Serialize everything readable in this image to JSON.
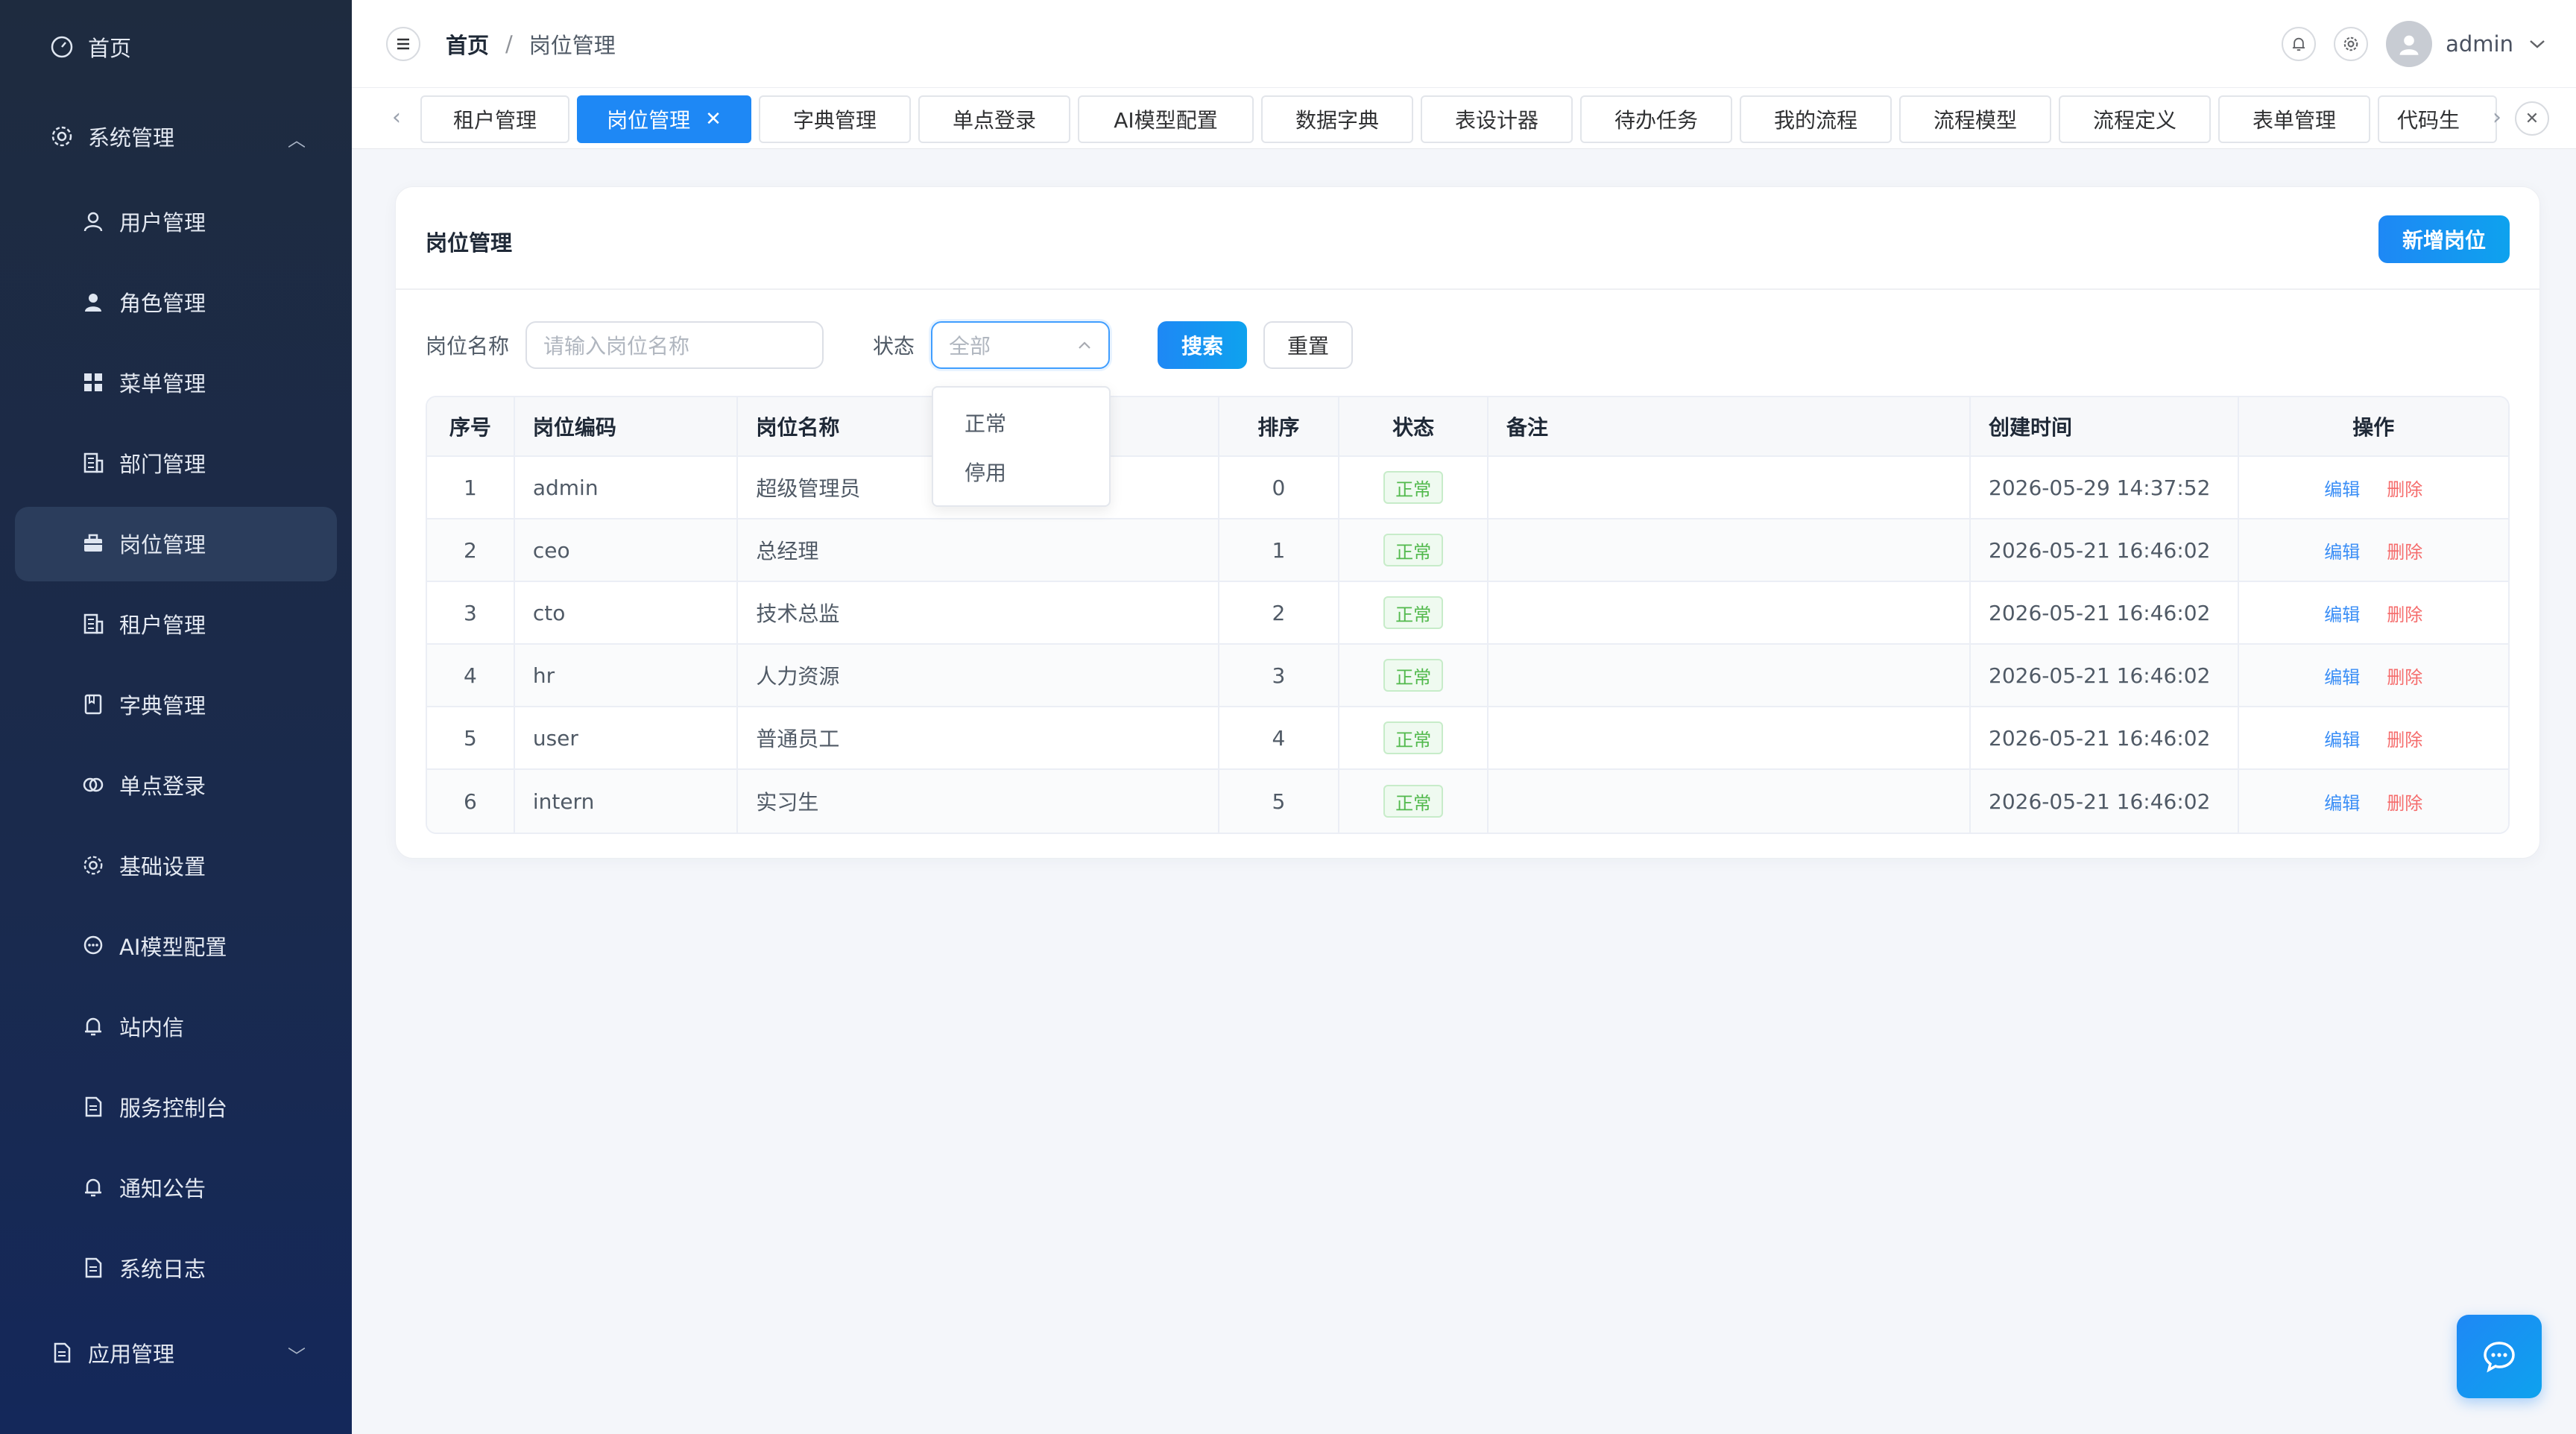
{
  "sidebar": {
    "items": [
      {
        "label": "首页",
        "icon": "dashboard-icon"
      },
      {
        "label": "系统管理",
        "icon": "gear-icon"
      },
      {
        "label": "用户管理",
        "icon": "user-icon"
      },
      {
        "label": "角色管理",
        "icon": "user-filled-icon"
      },
      {
        "label": "菜单管理",
        "icon": "grid-icon"
      },
      {
        "label": "部门管理",
        "icon": "building-icon"
      },
      {
        "label": "岗位管理",
        "icon": "briefcase-icon"
      },
      {
        "label": "租户管理",
        "icon": "building-icon"
      },
      {
        "label": "字典管理",
        "icon": "notebook-icon"
      },
      {
        "label": "单点登录",
        "icon": "link-icon"
      },
      {
        "label": "基础设置",
        "icon": "gear-icon"
      },
      {
        "label": "AI模型配置",
        "icon": "chat-icon"
      },
      {
        "label": "站内信",
        "icon": "bell-icon"
      },
      {
        "label": "服务控制台",
        "icon": "document-icon"
      },
      {
        "label": "通知公告",
        "icon": "bell-icon"
      },
      {
        "label": "系统日志",
        "icon": "document-icon"
      },
      {
        "label": "应用管理",
        "icon": "document-icon"
      }
    ]
  },
  "header": {
    "breadcrumb_home": "首页",
    "breadcrumb_sep": "/",
    "breadcrumb_current": "岗位管理",
    "username": "admin"
  },
  "tabs": [
    {
      "label": "租户管理"
    },
    {
      "label": "岗位管理",
      "active": true
    },
    {
      "label": "字典管理"
    },
    {
      "label": "单点登录"
    },
    {
      "label": "AI模型配置"
    },
    {
      "label": "数据字典"
    },
    {
      "label": "表设计器"
    },
    {
      "label": "待办任务"
    },
    {
      "label": "我的流程"
    },
    {
      "label": "流程模型"
    },
    {
      "label": "流程定义"
    },
    {
      "label": "表单管理"
    },
    {
      "label": "代码生"
    }
  ],
  "card": {
    "title": "岗位管理",
    "add_button": "新增岗位"
  },
  "filter": {
    "name_label": "岗位名称",
    "name_placeholder": "请输入岗位名称",
    "status_label": "状态",
    "status_value": "全部",
    "search_button": "搜索",
    "reset_button": "重置",
    "status_options": [
      "正常",
      "停用"
    ]
  },
  "table": {
    "columns": [
      "序号",
      "岗位编码",
      "岗位名称",
      "排序",
      "状态",
      "备注",
      "创建时间",
      "操作"
    ],
    "rows": [
      {
        "no": "1",
        "code": "admin",
        "name": "超级管理员",
        "sort": "0",
        "status": "正常",
        "remark": "",
        "created": "2026-05-29 14:37:52"
      },
      {
        "no": "2",
        "code": "ceo",
        "name": "总经理",
        "sort": "1",
        "status": "正常",
        "remark": "",
        "created": "2026-05-21 16:46:02"
      },
      {
        "no": "3",
        "code": "cto",
        "name": "技术总监",
        "sort": "2",
        "status": "正常",
        "remark": "",
        "created": "2026-05-21 16:46:02"
      },
      {
        "no": "4",
        "code": "hr",
        "name": "人力资源",
        "sort": "3",
        "status": "正常",
        "remark": "",
        "created": "2026-05-21 16:46:02"
      },
      {
        "no": "5",
        "code": "user",
        "name": "普通员工",
        "sort": "4",
        "status": "正常",
        "remark": "",
        "created": "2026-05-21 16:46:02"
      },
      {
        "no": "6",
        "code": "intern",
        "name": "实习生",
        "sort": "5",
        "status": "正常",
        "remark": "",
        "created": "2026-05-21 16:46:02"
      }
    ],
    "edit_label": "编辑",
    "delete_label": "删除"
  },
  "colors": {
    "primary": "#1e88f5",
    "sidebar_bg": "#1e2b3f",
    "success": "#52b94d",
    "danger": "#f56c6c"
  }
}
